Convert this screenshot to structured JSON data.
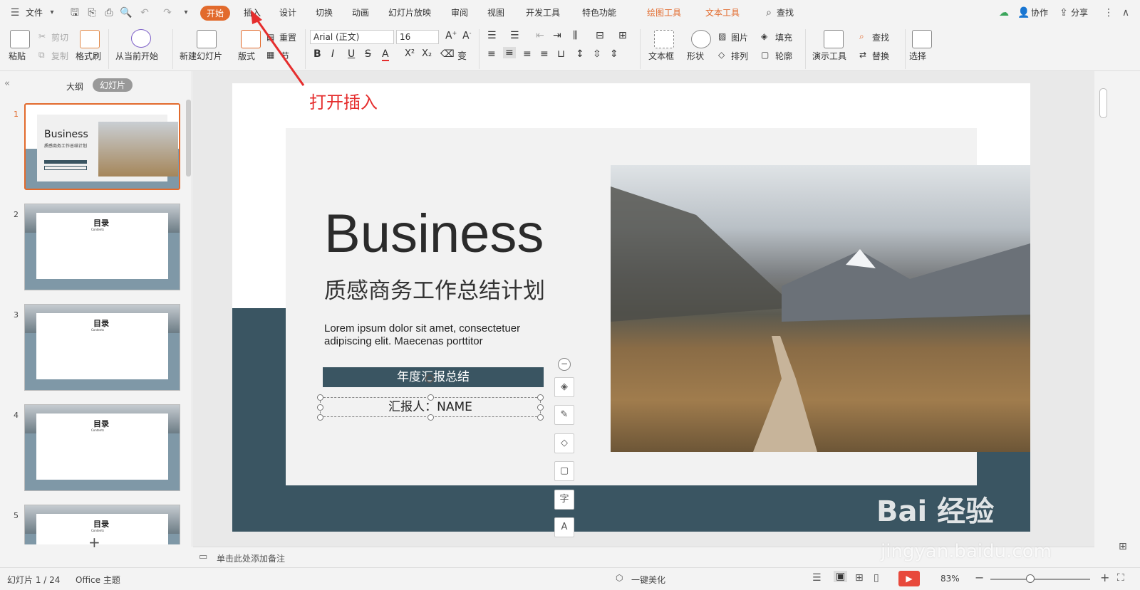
{
  "menubar": {
    "file_label": "文件",
    "tabs": [
      "开始",
      "插入",
      "设计",
      "切换",
      "动画",
      "幻灯片放映",
      "审阅",
      "视图",
      "开发工具",
      "特色功能"
    ],
    "context_tabs": [
      "绘图工具",
      "文本工具"
    ],
    "search_label": "查找",
    "collab_label": "协作",
    "share_label": "分享"
  },
  "ribbon": {
    "paste": "粘贴",
    "cut": "剪切",
    "copy": "复制",
    "format_painter": "格式刷",
    "from_current": "从当前开始",
    "new_slide": "新建幻灯片",
    "layout": "版式",
    "section": "节",
    "reset": "重置",
    "font_name": "Arial (正文)",
    "font_size": "16",
    "textbox": "文本框",
    "shape": "形状",
    "picture": "图片",
    "fill": "填充",
    "arrange": "排列",
    "outline": "轮廓",
    "present_tools": "演示工具",
    "find": "查找",
    "replace": "替换",
    "select": "选择"
  },
  "annotation": {
    "text": "打开插入",
    "color": "#e52d2d"
  },
  "panel": {
    "outline_tab": "大纲",
    "slides_tab": "幻灯片"
  },
  "thumbnails": [
    {
      "num": "1",
      "title": "Business",
      "subtitle": "质感商务工作总结计划"
    },
    {
      "num": "2",
      "title": "目录",
      "subtitle": "Contents"
    },
    {
      "num": "3",
      "title": "目录",
      "subtitle": "Contents"
    },
    {
      "num": "4",
      "title": "目录",
      "subtitle": "Contents"
    },
    {
      "num": "5",
      "title": "目录",
      "subtitle": "Contents"
    }
  ],
  "slide": {
    "title": "Business",
    "subtitle": "质感商务工作总结计划",
    "body_line1": "Lorem ipsum dolor sit amet, consectetuer",
    "body_line2": "adipiscing elit. Maecenas porttitor",
    "banner": "年度汇报总结",
    "reporter": "汇报人：NAME",
    "accent_color": "#3a5562"
  },
  "notes": {
    "placeholder": "单击此处添加备注"
  },
  "status": {
    "slide_count": "幻灯片 1 / 24",
    "theme": "Office 主题",
    "beautify": "一键美化",
    "zoom": "83%"
  },
  "watermark": {
    "brand": "Bai 经验",
    "url": "jingyan.baidu.com"
  }
}
